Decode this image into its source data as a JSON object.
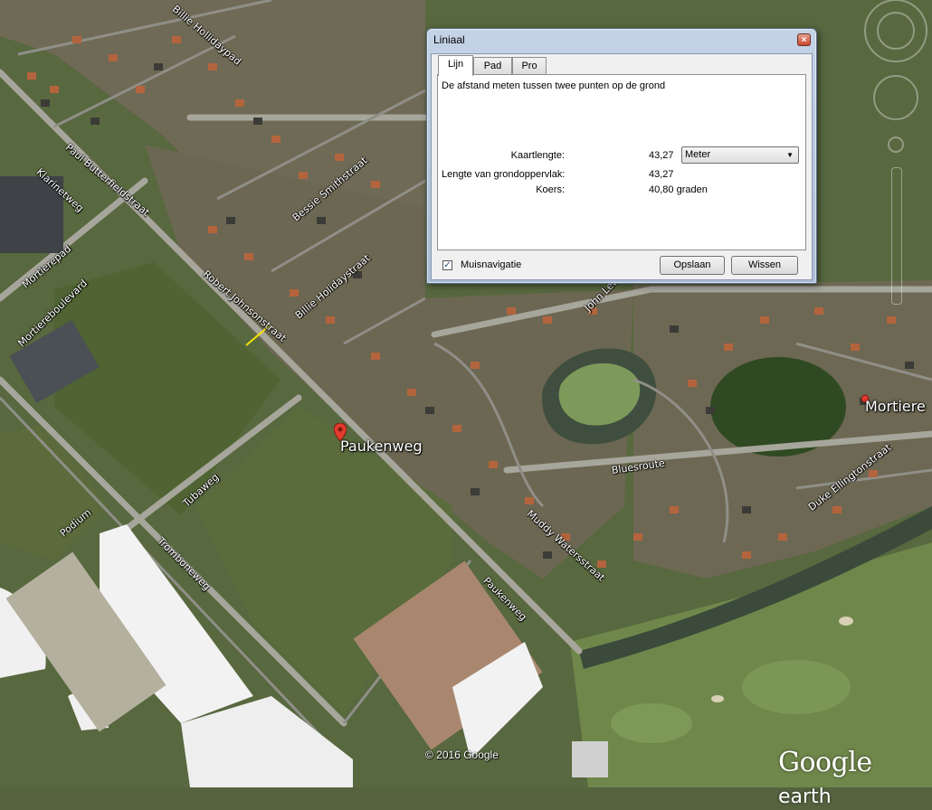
{
  "dialog": {
    "title": "Liniaal",
    "close_glyph": "×",
    "tabs": [
      {
        "label": "Lijn",
        "active": true
      },
      {
        "label": "Pad",
        "active": false
      },
      {
        "label": "Pro",
        "active": false
      }
    ],
    "description": "De afstand meten tussen twee punten op de grond",
    "map_length_label": "Kaartlengte:",
    "map_length_value": "43,27",
    "unit_selected": "Meter",
    "ground_length_label": "Lengte van grondoppervlak:",
    "ground_length_value": "43,27",
    "heading_label": "Koers:",
    "heading_value": "40,80 graden",
    "mouse_nav_label": "Muisnavigatie",
    "mouse_nav_checked": true,
    "save_label": "Opslaan",
    "clear_label": "Wissen"
  },
  "map": {
    "street_labels": [
      "Billie Hollidaypad",
      "Paul Butterfieldstraat",
      "Klarinetweg",
      "Mortierepad",
      "Mortiereboulevard",
      "Robert Johnsonstraat",
      "Billie Holidaystraat",
      "Bessie Smithstraat",
      "John Lee",
      "Tubaweg",
      "Podium",
      "Tromboneweg",
      "Paukenweg",
      "Muddy Watersstraat",
      "Bluesroute",
      "Duke Ellingtonstraat"
    ],
    "place_labels": [
      "Paukenweg",
      "Mortiere"
    ],
    "copyright": "© 2016 Google",
    "logo_google": "Google",
    "logo_earth": "earth",
    "ruler_color": "#f5e400",
    "pin_color": "#e23b2e"
  }
}
